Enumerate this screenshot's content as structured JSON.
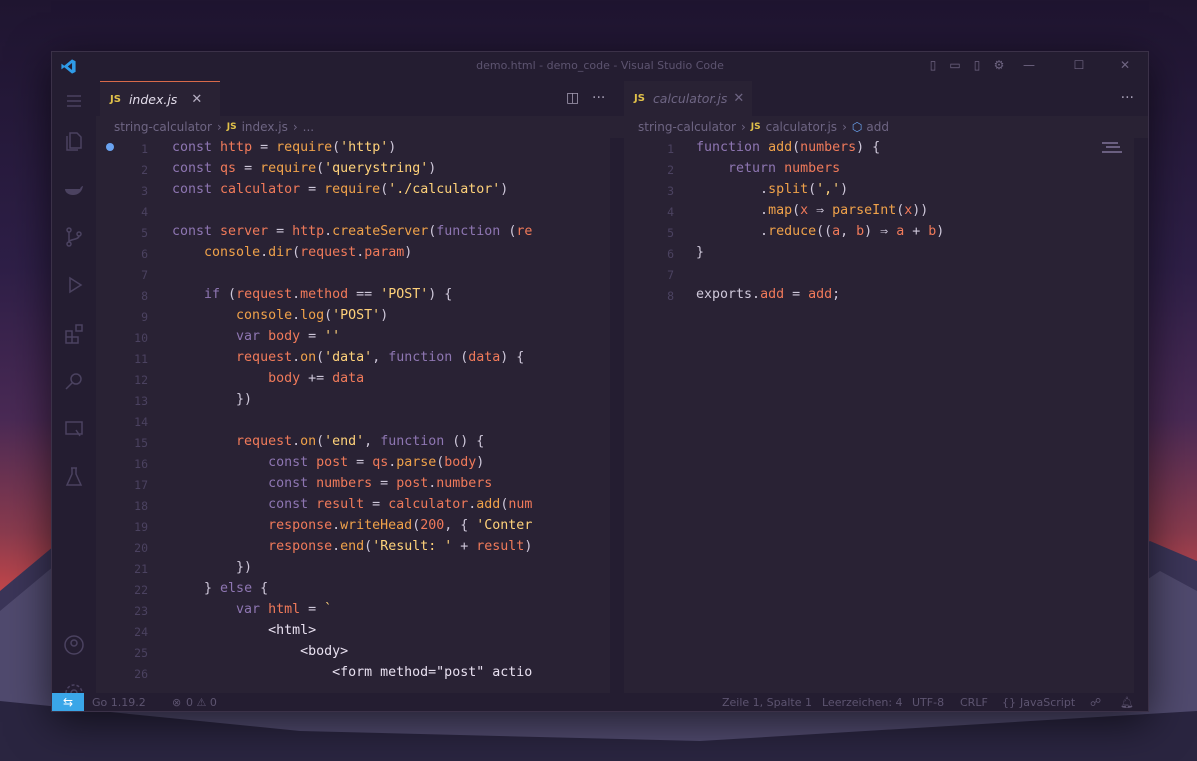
{
  "window": {
    "title": "demo.html - demo_code - Visual Studio Code"
  },
  "left": {
    "tab": {
      "label": "index.js",
      "icon_text": "JS"
    },
    "breadcrumb": {
      "folder": "string-calculator",
      "file": "index.js",
      "more": "..."
    },
    "lines": [
      {
        "n": "1",
        "html": "<span class='k'>const</span> <span class='v'>http</span> = <span class='f'>require</span>(<span class='s'>'http'</span>)"
      },
      {
        "n": "2",
        "html": "<span class='k'>const</span> <span class='v'>qs</span> = <span class='f'>require</span>(<span class='s'>'querystring'</span>)"
      },
      {
        "n": "3",
        "html": "<span class='k'>const</span> <span class='v'>calculator</span> = <span class='f'>require</span>(<span class='s'>'./calculator'</span>)"
      },
      {
        "n": "4",
        "html": ""
      },
      {
        "n": "5",
        "html": "<span class='k'>const</span> <span class='v'>server</span> = <span class='v'>http</span>.<span class='f'>createServer</span>(<span class='k'>function</span> (<span class='v'>re</span>"
      },
      {
        "n": "6",
        "html": "    <span class='f'>console</span>.<span class='f'>dir</span>(<span class='v'>request</span>.<span class='v'>param</span>)"
      },
      {
        "n": "7",
        "html": ""
      },
      {
        "n": "8",
        "html": "    <span class='k'>if</span> (<span class='v'>request</span>.<span class='v'>method</span> == <span class='s'>'POST'</span>) {"
      },
      {
        "n": "9",
        "html": "        <span class='f'>console</span>.<span class='f'>log</span>(<span class='s'>'POST'</span>)"
      },
      {
        "n": "10",
        "html": "        <span class='k'>var</span> <span class='v'>body</span> = <span class='s'>''</span>"
      },
      {
        "n": "11",
        "html": "        <span class='v'>request</span>.<span class='f'>on</span>(<span class='s'>'data'</span>, <span class='k'>function</span> (<span class='v'>data</span>) {"
      },
      {
        "n": "12",
        "html": "            <span class='v'>body</span> += <span class='v'>data</span>"
      },
      {
        "n": "13",
        "html": "        })"
      },
      {
        "n": "14",
        "html": ""
      },
      {
        "n": "15",
        "html": "        <span class='v'>request</span>.<span class='f'>on</span>(<span class='s'>'end'</span>, <span class='k'>function</span> () {"
      },
      {
        "n": "16",
        "html": "            <span class='k'>const</span> <span class='v'>post</span> = <span class='v'>qs</span>.<span class='f'>parse</span>(<span class='v'>body</span>)"
      },
      {
        "n": "17",
        "html": "            <span class='k'>const</span> <span class='v'>numbers</span> = <span class='v'>post</span>.<span class='v'>numbers</span>"
      },
      {
        "n": "18",
        "html": "            <span class='k'>const</span> <span class='v'>result</span> = <span class='v'>calculator</span>.<span class='f'>add</span>(<span class='v'>num</span>"
      },
      {
        "n": "19",
        "html": "            <span class='v'>response</span>.<span class='f'>writeHead</span>(<span class='n'>200</span>, { <span class='s'>'Conter</span>"
      },
      {
        "n": "20",
        "html": "            <span class='v'>response</span>.<span class='f'>end</span>(<span class='s'>'Result: '</span> + <span class='v'>result</span>)"
      },
      {
        "n": "21",
        "html": "        })"
      },
      {
        "n": "22",
        "html": "    } <span class='k'>else</span> {"
      },
      {
        "n": "23",
        "html": "        <span class='k'>var</span> <span class='v'>html</span> = <span class='s'>`</span>"
      },
      {
        "n": "24",
        "html": "            <span class='b'>&lt;html&gt;</span>"
      },
      {
        "n": "25",
        "html": "                <span class='b'>&lt;body&gt;</span>"
      },
      {
        "n": "26",
        "html": "                    <span class='b'>&lt;form method=\"post\" actio</span>"
      }
    ]
  },
  "right": {
    "tab": {
      "label": "calculator.js",
      "icon_text": "JS"
    },
    "breadcrumb": {
      "folder": "string-calculator",
      "file": "calculator.js",
      "symbol": "add"
    },
    "lines": [
      {
        "n": "1",
        "html": "<span class='k'>function</span> <span class='f'>add</span>(<span class='v'>numbers</span>) {"
      },
      {
        "n": "2",
        "html": "    <span class='k'>return</span> <span class='v'>numbers</span>"
      },
      {
        "n": "3",
        "html": "        .<span class='f'>split</span>(<span class='s'>','</span>)"
      },
      {
        "n": "4",
        "html": "        .<span class='f'>map</span>(<span class='v'>x</span> ⇒ <span class='f'>parseInt</span>(<span class='v'>x</span>))"
      },
      {
        "n": "5",
        "html": "        .<span class='f'>reduce</span>((<span class='v'>a</span>, <span class='v'>b</span>) ⇒ <span class='v'>a</span> + <span class='v'>b</span>)"
      },
      {
        "n": "6",
        "html": "}"
      },
      {
        "n": "7",
        "html": ""
      },
      {
        "n": "8",
        "html": "<span class='p'>exports</span>.<span class='v'>add</span> = <span class='v'>add</span>;"
      }
    ]
  },
  "status": {
    "go": "Go 1.19.2",
    "problems": "0 ⚠ 0",
    "position": "Zeile 1, Spalte 1",
    "spaces": "Leerzeichen: 4",
    "encoding": "UTF-8",
    "eol": "CRLF",
    "language": "JavaScript"
  },
  "colors": {
    "accent": "#3aa6e8",
    "tab_border": "#d86a4a"
  }
}
